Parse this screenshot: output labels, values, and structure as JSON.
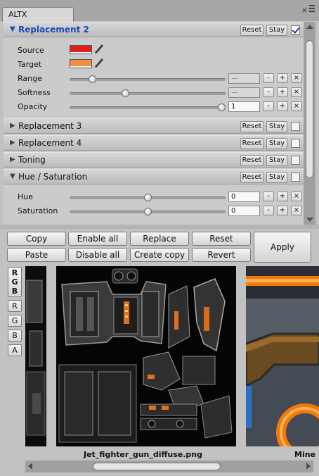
{
  "window": {
    "tab_title": "ALTX"
  },
  "sections": {
    "replacement2": {
      "title": "Replacement 2",
      "reset": "Reset",
      "stay": "Stay",
      "checked": true
    },
    "replacement3": {
      "title": "Replacement 3",
      "reset": "Reset",
      "stay": "Stay",
      "checked": false
    },
    "replacement4": {
      "title": "Replacement 4",
      "reset": "Reset",
      "stay": "Stay",
      "checked": false
    },
    "toning": {
      "title": "Toning",
      "reset": "Reset",
      "stay": "Stay",
      "checked": false
    },
    "hue_saturation": {
      "title": "Hue / Saturation",
      "reset": "Reset",
      "stay": "Stay",
      "checked": false
    }
  },
  "replacement2": {
    "source_label": "Source",
    "target_label": "Target",
    "source_color": "#e02020",
    "target_color": "#f09040",
    "range": {
      "label": "Range",
      "value": "—",
      "level": 0.13
    },
    "softness": {
      "label": "Softness",
      "value": "—",
      "level": 0.35
    },
    "opacity": {
      "label": "Opacity",
      "value": "1",
      "level": 1.0
    }
  },
  "hue_saturation": {
    "hue": {
      "label": "Hue",
      "value": "0",
      "level": 0.5
    },
    "saturation": {
      "label": "Saturation",
      "value": "0",
      "level": 0.5
    }
  },
  "stepper": {
    "minus": "-",
    "plus": "+",
    "remove": "×"
  },
  "actions": {
    "copy": "Copy",
    "paste": "Paste",
    "enable_all": "Enable all",
    "disable_all": "Disable all",
    "replace": "Replace",
    "create_copy": "Create copy",
    "reset": "Reset",
    "revert": "Revert",
    "apply": "Apply"
  },
  "channels": {
    "rgb_r": "R",
    "rgb_g": "G",
    "rgb_b": "B",
    "r": "R",
    "g": "G",
    "b": "B",
    "a": "A"
  },
  "preview": {
    "current_file": "Jet_fighter_gun_diffuse.png",
    "next_file_partial": "Mine"
  }
}
